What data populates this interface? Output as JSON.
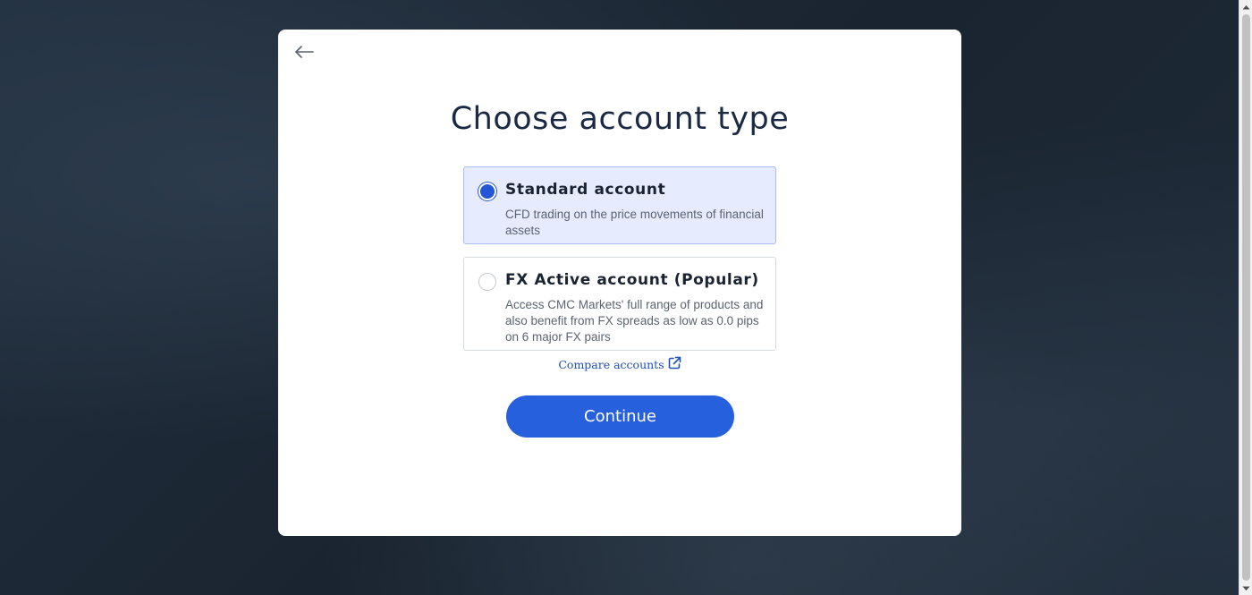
{
  "header": {
    "back_icon": "arrow-left-icon"
  },
  "main": {
    "title": "Choose account type",
    "options": [
      {
        "title": "Standard account",
        "description": "CFD trading on the price movements of financial assets",
        "selected": true
      },
      {
        "title": "FX Active account (Popular)",
        "description": "Access CMC Markets' full range of products and also benefit from FX spreads as low as 0.0 pips on 6 major FX pairs",
        "selected": false
      }
    ],
    "compare_link": "Compare accounts",
    "compare_icon": "external-link-icon",
    "continue_label": "Continue"
  },
  "colors": {
    "accent": "#2660dc",
    "selected_bg": "#e6ecfd",
    "link": "#1f4fb8"
  }
}
